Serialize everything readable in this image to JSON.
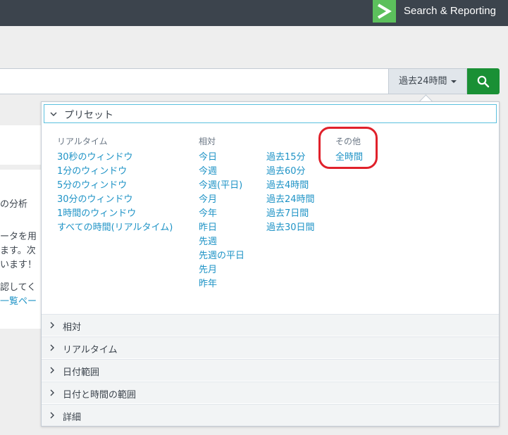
{
  "header": {
    "app_title": "Search & Reporting"
  },
  "search": {
    "time_range_label": "過去24時間"
  },
  "background": {
    "lines": [
      "の分析",
      "ータを用",
      "ます。次",
      "います！",
      "認してく",
      "一覧ペー"
    ]
  },
  "presets": {
    "header_label": "プリセット",
    "realtime": {
      "title": "リアルタイム",
      "items": [
        "30秒のウィンドウ",
        "1分のウィンドウ",
        "5分のウィンドウ",
        "30分のウィンドウ",
        "1時間のウィンドウ",
        "すべての時間(リアルタイム)"
      ]
    },
    "relative": {
      "title": "相対",
      "items_col1": [
        "今日",
        "今週",
        "今週(平日)",
        "今月",
        "今年",
        "昨日",
        "先週",
        "先週の平日",
        "先月",
        "昨年"
      ],
      "items_col2": [
        "過去15分",
        "過去60分",
        "過去4時間",
        "過去24時間",
        "過去7日間",
        "過去30日間"
      ]
    },
    "other": {
      "title": "その他",
      "items": [
        "全時間"
      ]
    }
  },
  "sections": [
    "相対",
    "リアルタイム",
    "日付範囲",
    "日付と時間の範囲",
    "詳細"
  ],
  "colors": {
    "link": "#1e93c6",
    "accent_green": "#1a9035",
    "logo_green": "#5cc05c",
    "highlight": "#e0212b"
  }
}
